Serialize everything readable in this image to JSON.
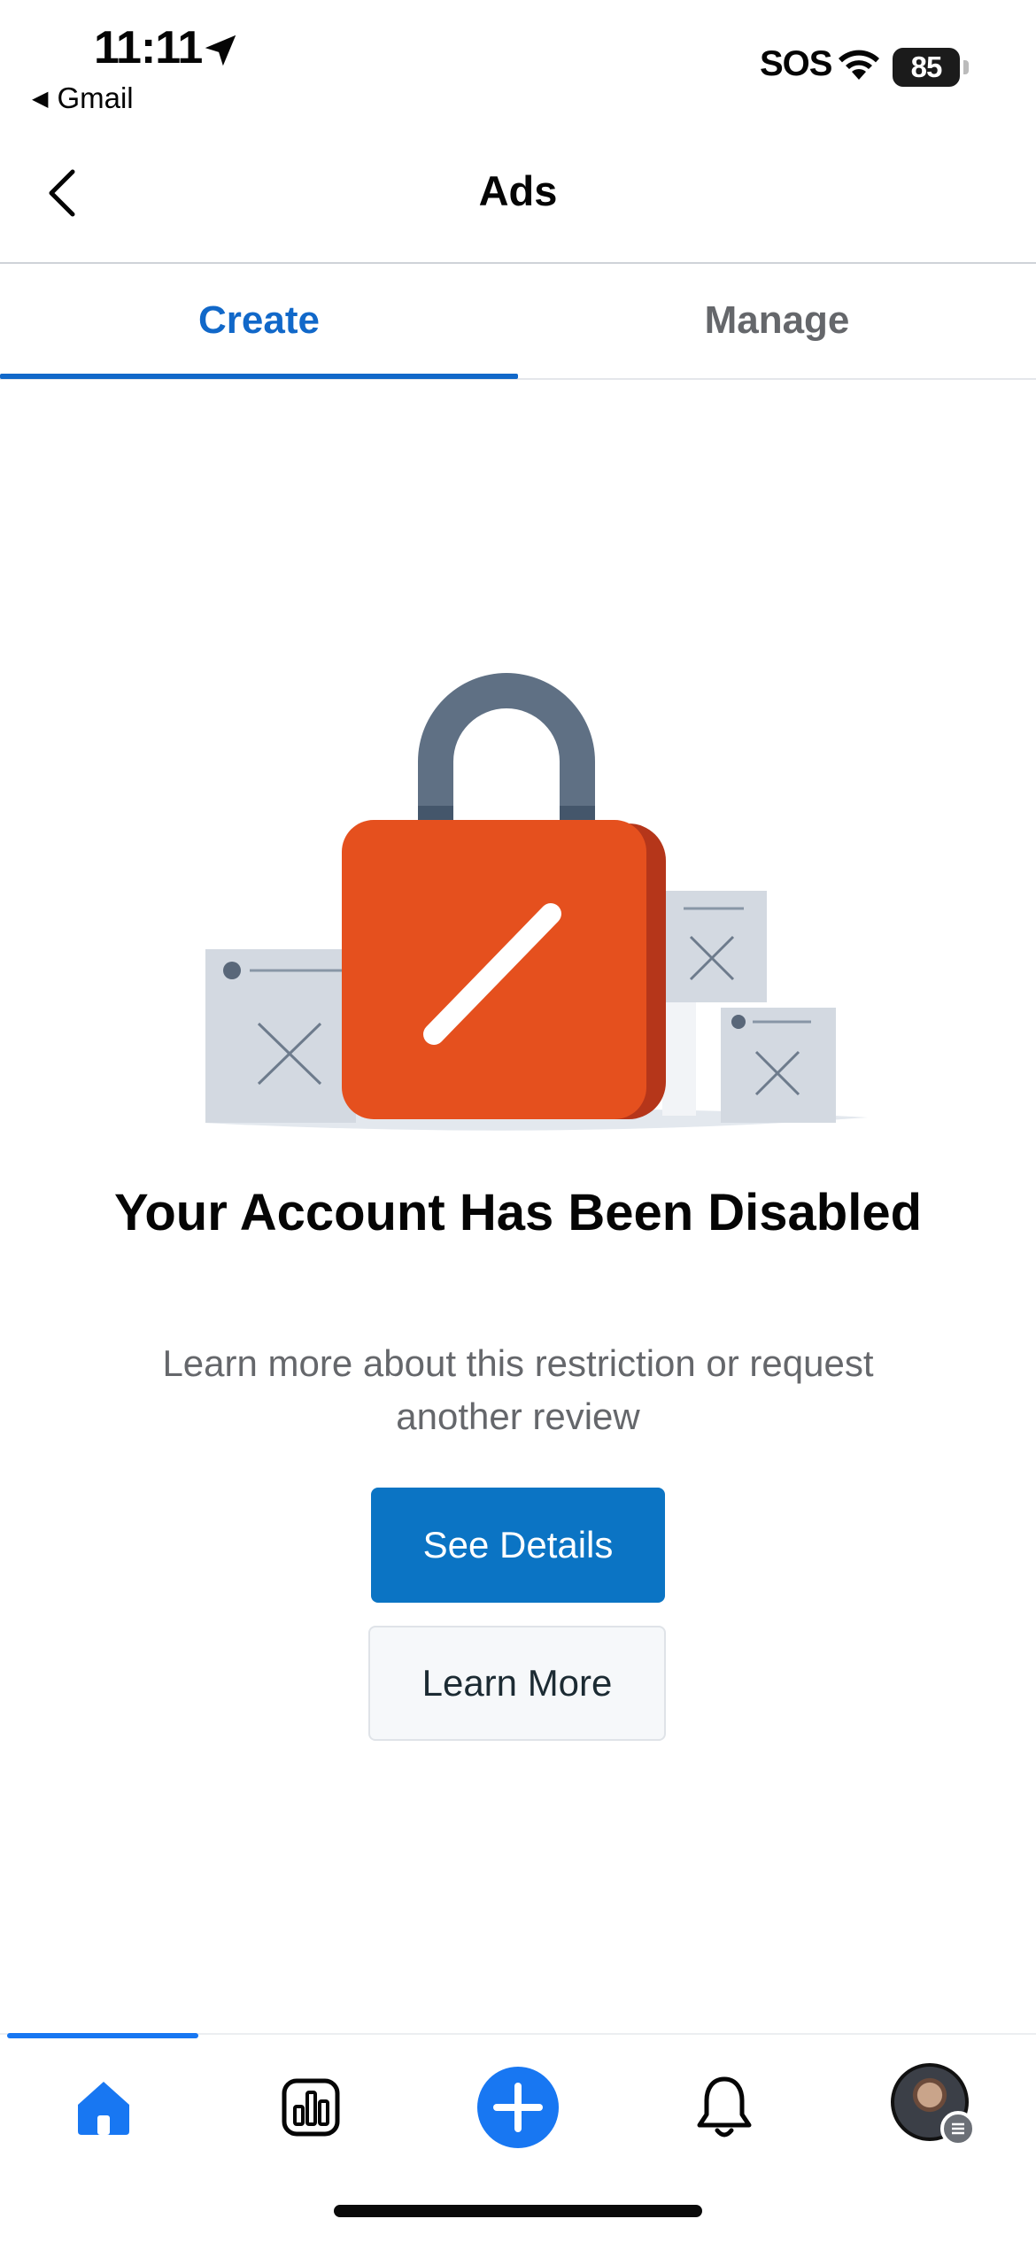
{
  "status_bar": {
    "time": "11:11",
    "back_app": "Gmail",
    "sos": "SOS",
    "battery": "85"
  },
  "header": {
    "title": "Ads",
    "back_icon": "chevron-left-icon"
  },
  "tabs": [
    {
      "label": "Create",
      "active": true
    },
    {
      "label": "Manage",
      "active": false
    }
  ],
  "main": {
    "illustration": "padlock-illustration",
    "heading": "Your Account Has Been Disabled",
    "description": "Learn more about this restriction or request another review",
    "primary_button": "See Details",
    "secondary_button": "Learn More"
  },
  "bottom_bar": {
    "items": [
      {
        "icon": "home-icon",
        "active": true
      },
      {
        "icon": "insights-chart-icon",
        "active": false
      },
      {
        "icon": "create-plus-icon",
        "active": false
      },
      {
        "icon": "notifications-bell-icon",
        "active": false
      },
      {
        "icon": "profile-avatar",
        "active": false
      }
    ]
  },
  "colors": {
    "accent": "#1168c9",
    "primary_button": "#0b74c4",
    "lock_body": "#e5501e",
    "lock_shackle": "#5f7084"
  }
}
